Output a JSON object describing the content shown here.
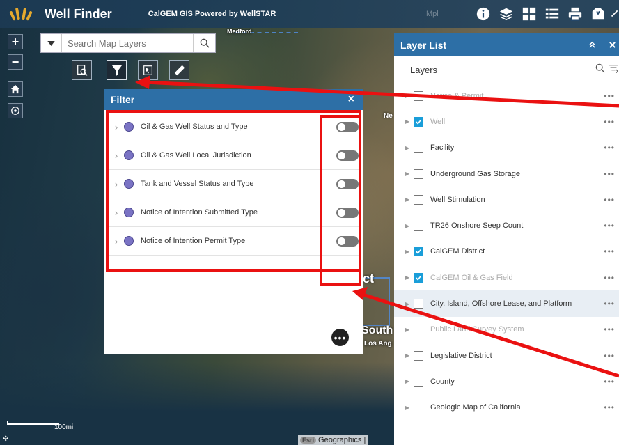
{
  "header": {
    "title": "Well Finder",
    "subtitle": "CalGEM GIS Powered by WellSTAR",
    "faint_label": "Mpl",
    "tools": [
      "info-icon",
      "layers-icon",
      "basemap-gallery-icon",
      "legend-icon",
      "print-icon",
      "bookmark-icon",
      "more-icon"
    ]
  },
  "map_controls": {
    "zoom_in": "+",
    "zoom_out": "−"
  },
  "search": {
    "placeholder": "Search Map Layers"
  },
  "map_labels": {
    "medford": "Medford",
    "ne": "Ne",
    "ct": "ct",
    "south": "South",
    "los_ang": "Los Ang"
  },
  "filter": {
    "title": "Filter",
    "close": "×",
    "items": [
      {
        "label": "Oil & Gas Well Status and Type"
      },
      {
        "label": "Oil & Gas Well Local Jurisdiction"
      },
      {
        "label": "Tank and Vessel Status and Type"
      },
      {
        "label": "Notice of Intention Submitted Type"
      },
      {
        "label": "Notice of Intention Permit Type"
      }
    ]
  },
  "layer_list": {
    "title": "Layer List",
    "section_label": "Layers",
    "items": [
      {
        "label": "Notice & Permit",
        "checked": false,
        "faded": true
      },
      {
        "label": "Well",
        "checked": true,
        "faded": true
      },
      {
        "label": "Facility",
        "checked": false,
        "faded": false
      },
      {
        "label": "Underground Gas Storage",
        "checked": false,
        "faded": false
      },
      {
        "label": "Well Stimulation",
        "checked": false,
        "faded": false
      },
      {
        "label": "TR26 Onshore Seep Count",
        "checked": false,
        "faded": false
      },
      {
        "label": "CalGEM District",
        "checked": true,
        "faded": false
      },
      {
        "label": "CalGEM Oil & Gas Field",
        "checked": true,
        "faded": true
      },
      {
        "label": "City, Island, Offshore Lease, and Platform",
        "checked": false,
        "faded": false,
        "selected": true
      },
      {
        "label": "Public Land Survey System",
        "checked": false,
        "faded": true
      },
      {
        "label": "Legislative District",
        "checked": false,
        "faded": false
      },
      {
        "label": "County",
        "checked": false,
        "faded": false
      },
      {
        "label": "Geologic Map of California",
        "checked": false,
        "faded": false
      }
    ]
  },
  "scale": {
    "label": "100mi"
  },
  "attribution": {
    "esri": "Esri",
    "text": "Geographics |"
  },
  "colors": {
    "header_bg": "#1c3a54",
    "panel_header": "#2d6fa6",
    "annotation_red": "#ea1111",
    "checkbox_checked": "#1a9ed9",
    "filter_dot": "#7a73c4"
  }
}
